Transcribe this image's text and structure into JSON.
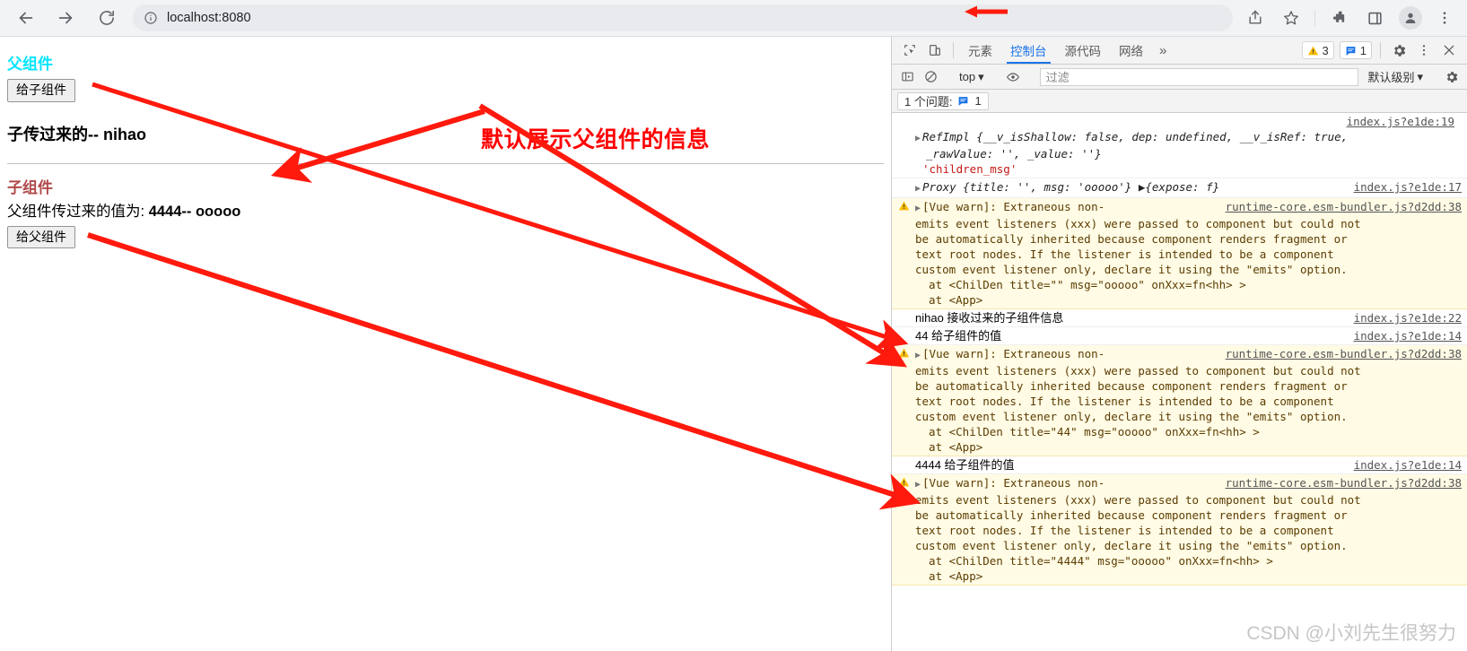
{
  "browser": {
    "url_text": "localhost:8080",
    "back_label": "back-arrow",
    "forward_label": "forward-arrow",
    "reload_label": "reload",
    "icons": [
      "share-icon",
      "star-icon",
      "extensions-icon",
      "sidepanel-icon",
      "profile-icon",
      "menu-icon"
    ]
  },
  "page": {
    "parent_title": "父组件",
    "give_child_button": "给子组件",
    "parent_received": "子传过来的-- nihao",
    "child_title": "子组件",
    "child_value_label": "父组件传过来的值为:",
    "child_value": "4444-- ooooo",
    "give_parent_button": "给父组件",
    "annotation": "默认展示父组件的信息"
  },
  "devtools": {
    "tabs": [
      {
        "label": "元素",
        "active": false
      },
      {
        "label": "控制台",
        "active": true
      },
      {
        "label": "源代码",
        "active": false
      },
      {
        "label": "网络",
        "active": false
      }
    ],
    "more_tabs": "»",
    "warning_badge": "3",
    "message_badge": "1",
    "settings_icon": "gear-icon",
    "kebab_icon": "more-vertical-icon",
    "close_icon": "close-icon",
    "console_toolbar": {
      "context": "top",
      "filter_placeholder": "过滤",
      "level": "默认级别"
    },
    "issues_bar": {
      "label": "1 个问题:",
      "count": "1"
    }
  },
  "console_messages": [
    {
      "type": "log",
      "source": "index.js?e1de:19",
      "line1_prefix": "RefImpl {",
      "line1_parts": "__v_isShallow: false, dep: undefined, __v_isRef: true,",
      "line2": "_rawValue: '', _value: ''}",
      "line3": "'children_msg'"
    },
    {
      "type": "log",
      "source": "index.js?e1de:17",
      "text": "Proxy {title: '', msg: 'ooooo'} ▶{expose: f}"
    },
    {
      "type": "warning",
      "source": "runtime-core.esm-bundler.js?d2dd:38",
      "head": "[Vue warn]: Extraneous non-",
      "lines": [
        "emits event listeners (xxx) were passed to component but could not",
        "be automatically inherited because component renders fragment or",
        "text root nodes. If the listener is intended to be a component",
        "custom event listener only, declare it using the \"emits\" option."
      ],
      "at_lines": [
        "  at <ChilDen title=\"\" msg=\"ooooo\" onXxx=fn<hh> >",
        "  at <App>"
      ]
    },
    {
      "type": "log",
      "source": "index.js?e1de:22",
      "text": "nihao 接收过来的子组件信息"
    },
    {
      "type": "log",
      "source": "index.js?e1de:14",
      "text": "44 给子组件的值"
    },
    {
      "type": "warning",
      "source": "runtime-core.esm-bundler.js?d2dd:38",
      "head": "[Vue warn]: Extraneous non-",
      "lines": [
        "emits event listeners (xxx) were passed to component but could not",
        "be automatically inherited because component renders fragment or",
        "text root nodes. If the listener is intended to be a component",
        "custom event listener only, declare it using the \"emits\" option."
      ],
      "at_lines": [
        "  at <ChilDen title=\"44\" msg=\"ooooo\" onXxx=fn<hh> >",
        "  at <App>"
      ]
    },
    {
      "type": "log",
      "source": "index.js?e1de:14",
      "text": "4444 给子组件的值"
    },
    {
      "type": "warning",
      "source": "runtime-core.esm-bundler.js?d2dd:38",
      "head": "[Vue warn]: Extraneous non-",
      "lines": [
        "emits event listeners (xxx) were passed to component but could not",
        "be automatically inherited because component renders fragment or",
        "text root nodes. If the listener is intended to be a component",
        "custom event listener only, declare it using the \"emits\" option."
      ],
      "at_lines": [
        "  at <ChilDen title=\"4444\" msg=\"ooooo\" onXxx=fn<hh> >",
        "  at <App>"
      ]
    }
  ],
  "watermark": "CSDN @小刘先生很努力",
  "colors": {
    "annotation_red": "#ff0000",
    "parent_title": "#00e5ff",
    "child_title": "#b14a4a",
    "devtools_accent": "#1a73e8",
    "warning_bg": "#fffbe5"
  }
}
